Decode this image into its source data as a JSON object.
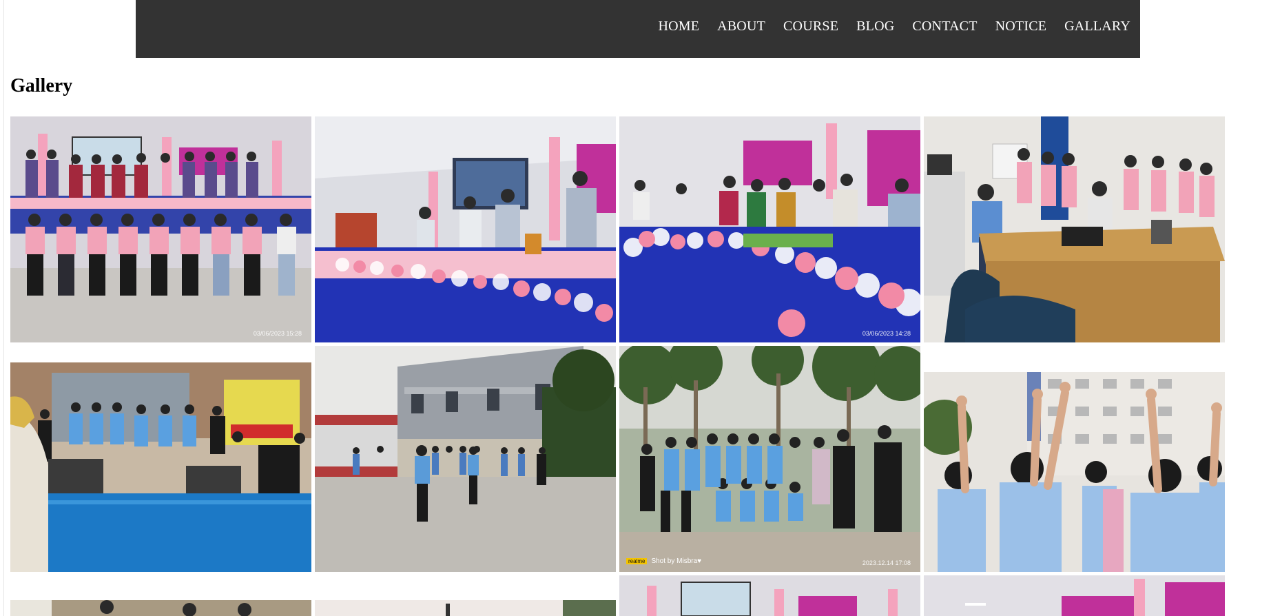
{
  "nav": {
    "items": [
      {
        "id": "home",
        "label": "HOME"
      },
      {
        "id": "about",
        "label": "ABOUT"
      },
      {
        "id": "course",
        "label": "COURSE"
      },
      {
        "id": "blog",
        "label": "BLOG"
      },
      {
        "id": "contact",
        "label": "CONTACT"
      },
      {
        "id": "notice",
        "label": "NOTICE"
      },
      {
        "id": "gallary",
        "label": "GALLARY"
      }
    ]
  },
  "page": {
    "title": "Gallery"
  },
  "gallery": {
    "photo1": {
      "timestamp": "03/06/2023  15:28"
    },
    "photo3": {
      "timestamp": "03/06/2023  14:28"
    },
    "photo7": {
      "camera_brand": "realme",
      "credit": "Shot by Misbra♥",
      "timestamp": "2023.12.14 17:08"
    }
  },
  "colors": {
    "navbar": "#333333",
    "nav_text": "#ffffff",
    "page_bg": "#ffffff"
  }
}
